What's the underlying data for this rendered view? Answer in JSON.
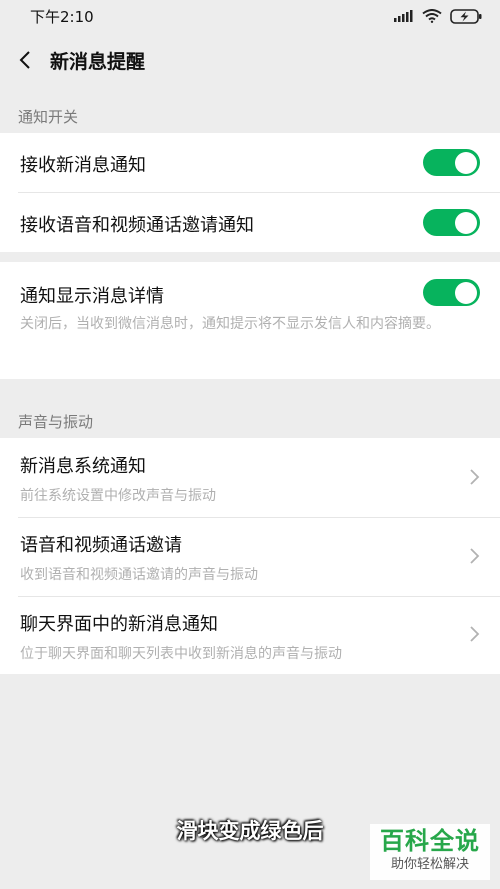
{
  "status_bar": {
    "time": "下午2:10"
  },
  "nav": {
    "title": "新消息提醒"
  },
  "section_notify": {
    "label": "通知开关",
    "items": [
      {
        "title": "接收新消息通知",
        "toggle_on": true
      },
      {
        "title": "接收语音和视频通话邀请通知",
        "toggle_on": true
      }
    ]
  },
  "detail_group": {
    "title": "通知显示消息详情",
    "toggle_on": true,
    "desc": "关闭后，当收到微信消息时，通知提示将不显示发信人和内容摘要。"
  },
  "section_sound": {
    "label": "声音与振动",
    "items": [
      {
        "title": "新消息系统通知",
        "desc": "前往系统设置中修改声音与振动"
      },
      {
        "title": "语音和视频通话邀请",
        "desc": "收到语音和视频通话邀请的声音与振动"
      },
      {
        "title": "聊天界面中的新消息通知",
        "desc": "位于聊天界面和聊天列表中收到新消息的声音与振动"
      }
    ]
  },
  "caption": "滑块变成绿色后",
  "watermark": {
    "main": "百科全说",
    "sub": "助你轻松解决"
  },
  "colors": {
    "accent": "#07b35d",
    "background": "#ededed",
    "card": "#ffffff"
  }
}
